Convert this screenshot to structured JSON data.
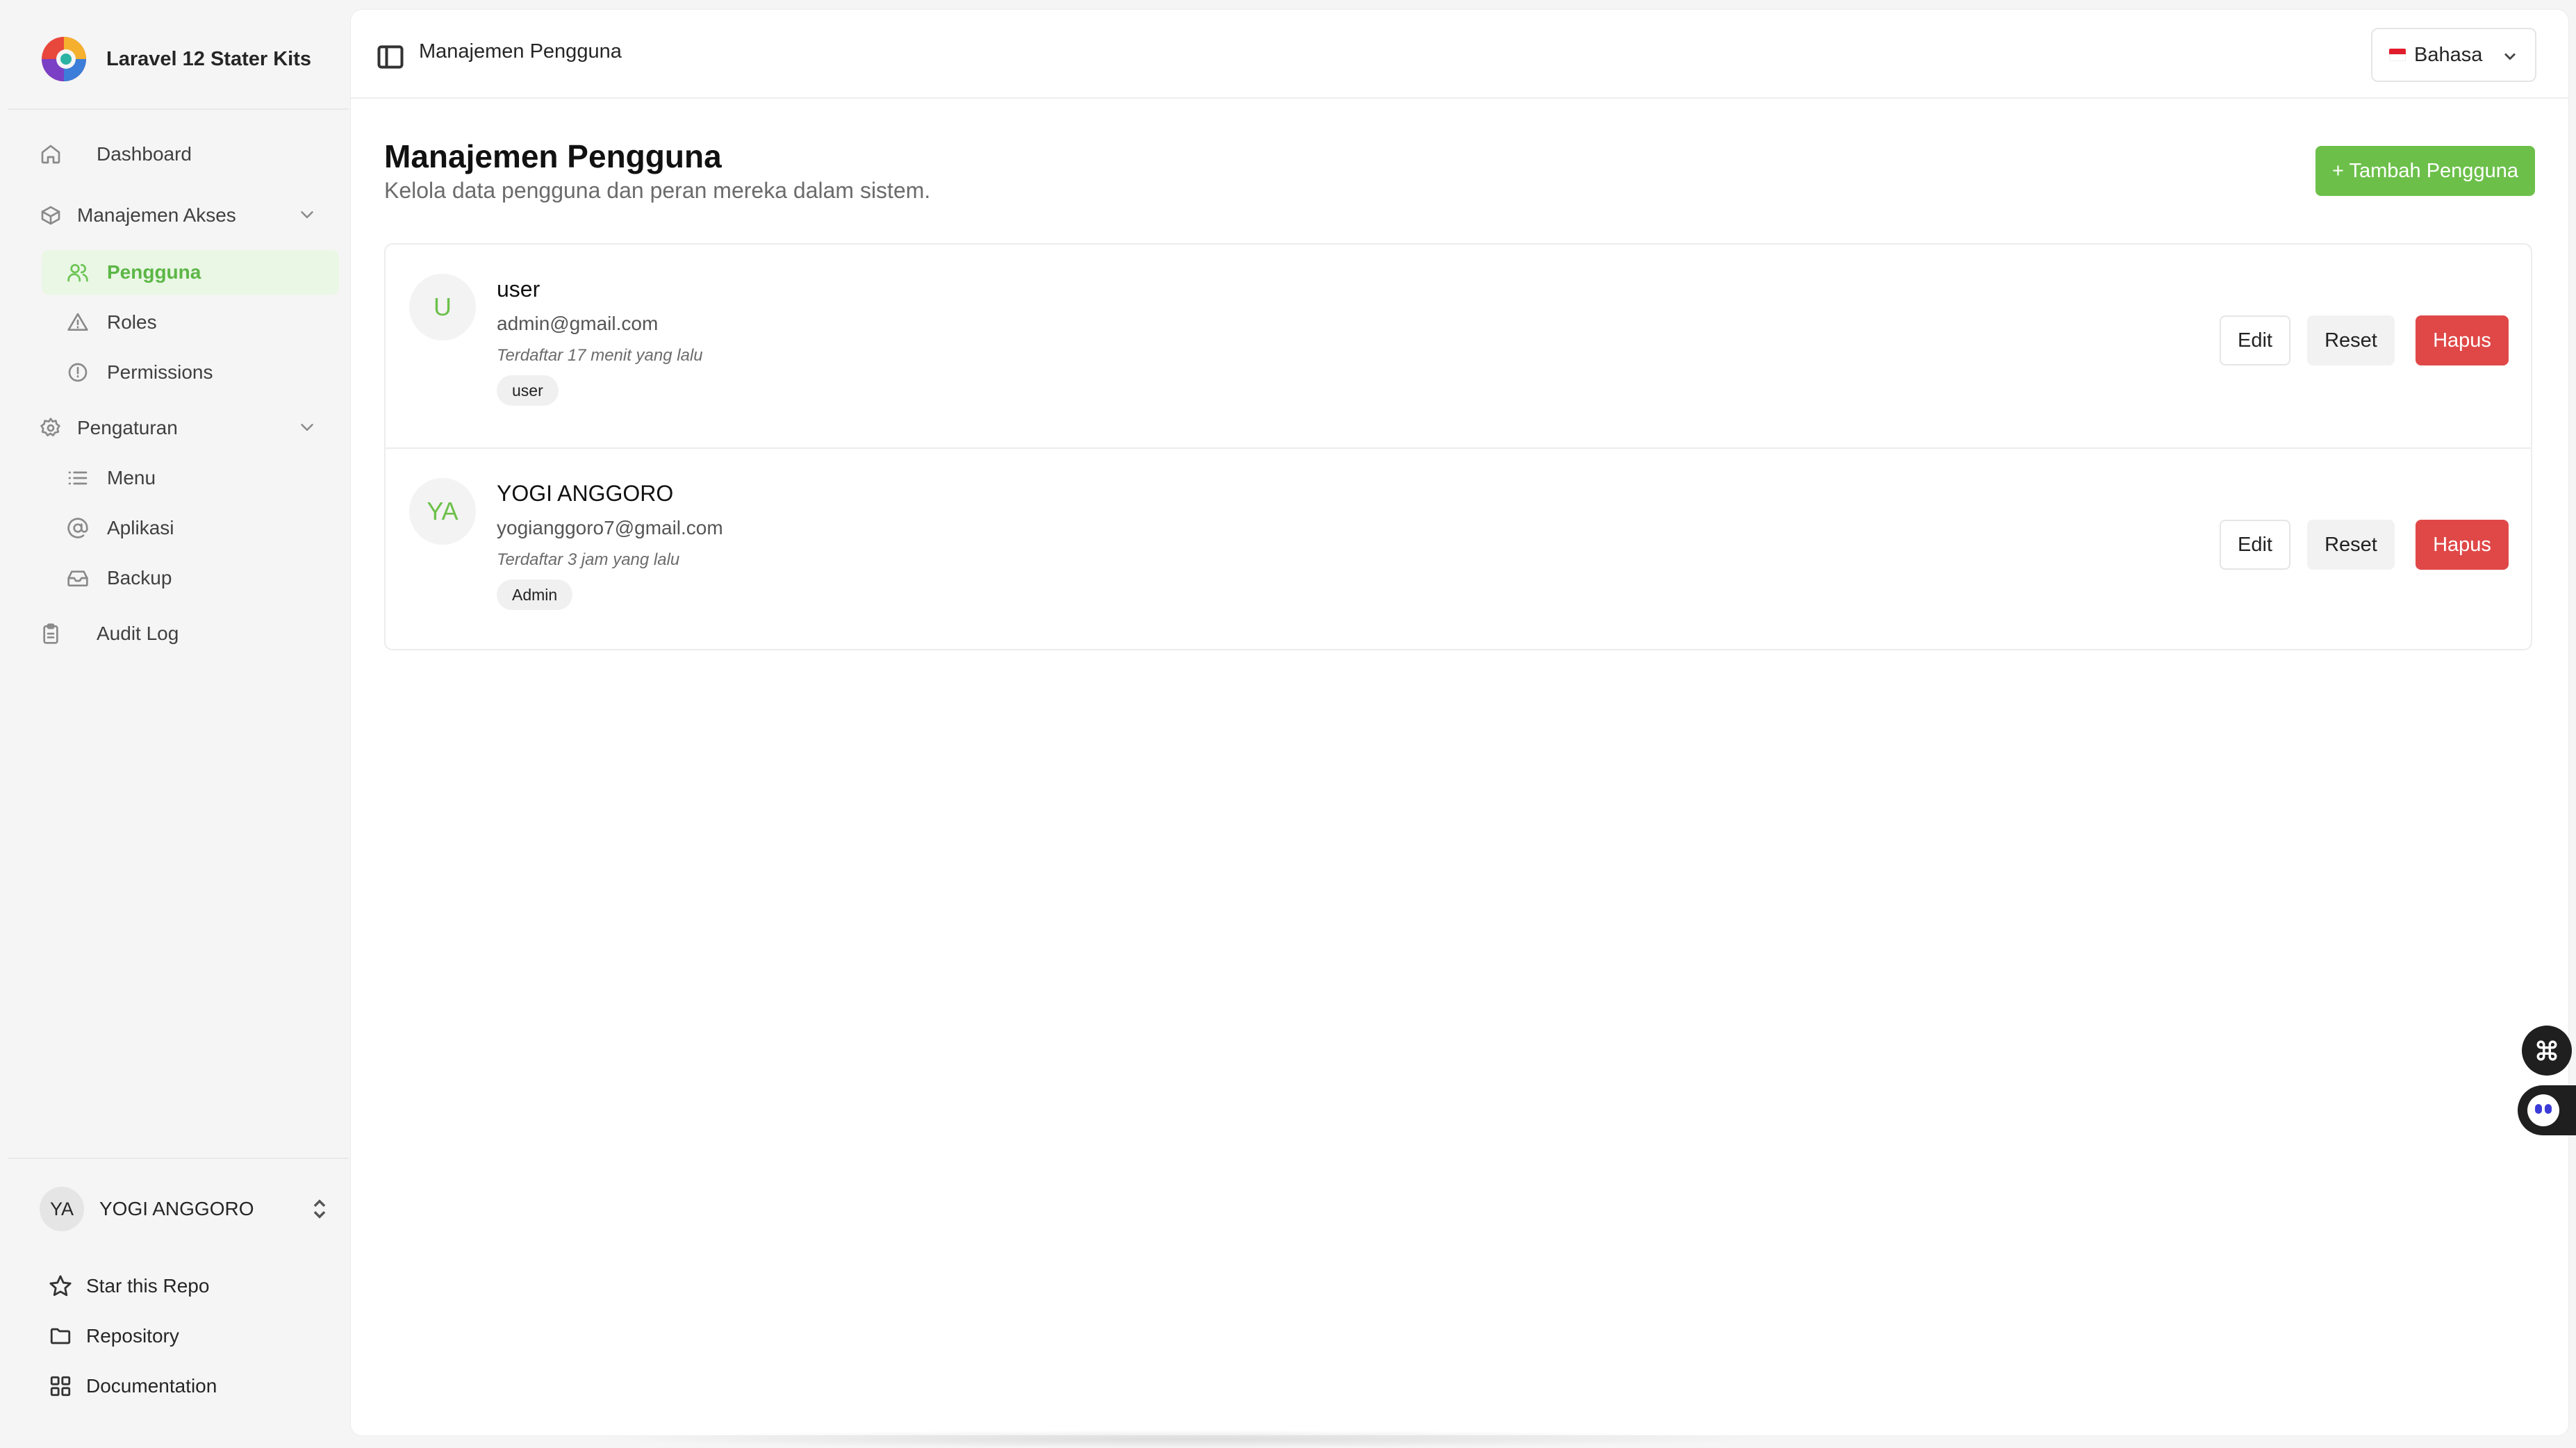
{
  "app": {
    "name": "Laravel 12 Stater Kits"
  },
  "sidebar": {
    "items": [
      {
        "label": "Dashboard"
      },
      {
        "label": "Manajemen Akses"
      },
      {
        "label": "Pengguna"
      },
      {
        "label": "Roles"
      },
      {
        "label": "Permissions"
      },
      {
        "label": "Pengaturan"
      },
      {
        "label": "Menu"
      },
      {
        "label": "Aplikasi"
      },
      {
        "label": "Backup"
      },
      {
        "label": "Audit Log"
      }
    ],
    "active_item": "Pengguna",
    "user": {
      "initials": "YA",
      "name": "YOGI ANGGORO"
    },
    "footer_links": [
      {
        "label": "Star this Repo"
      },
      {
        "label": "Repository"
      },
      {
        "label": "Documentation"
      }
    ]
  },
  "header": {
    "breadcrumb": "Manajemen Pengguna",
    "language_label": "Bahasa"
  },
  "page": {
    "title": "Manajemen Pengguna",
    "subtitle": "Kelola data pengguna dan peran mereka dalam sistem.",
    "add_button": "+ Tambah Pengguna"
  },
  "users": [
    {
      "initials": "U",
      "name": "user",
      "email": "admin@gmail.com",
      "registered": "Terdaftar 17 menit yang lalu",
      "role": "user"
    },
    {
      "initials": "YA",
      "name": "YOGI ANGGORO",
      "email": "yogianggoro7@gmail.com",
      "registered": "Terdaftar 3 jam yang lalu",
      "role": "Admin"
    }
  ],
  "actions": {
    "edit": "Edit",
    "reset": "Reset",
    "delete": "Hapus"
  },
  "colors": {
    "accent": "#6cc04a",
    "danger": "#e04848",
    "active_bg": "#e9f7e4"
  },
  "icons": {
    "toggle": "sidebar-toggle-icon",
    "command": "command-icon",
    "chat": "chatbot-icon"
  }
}
